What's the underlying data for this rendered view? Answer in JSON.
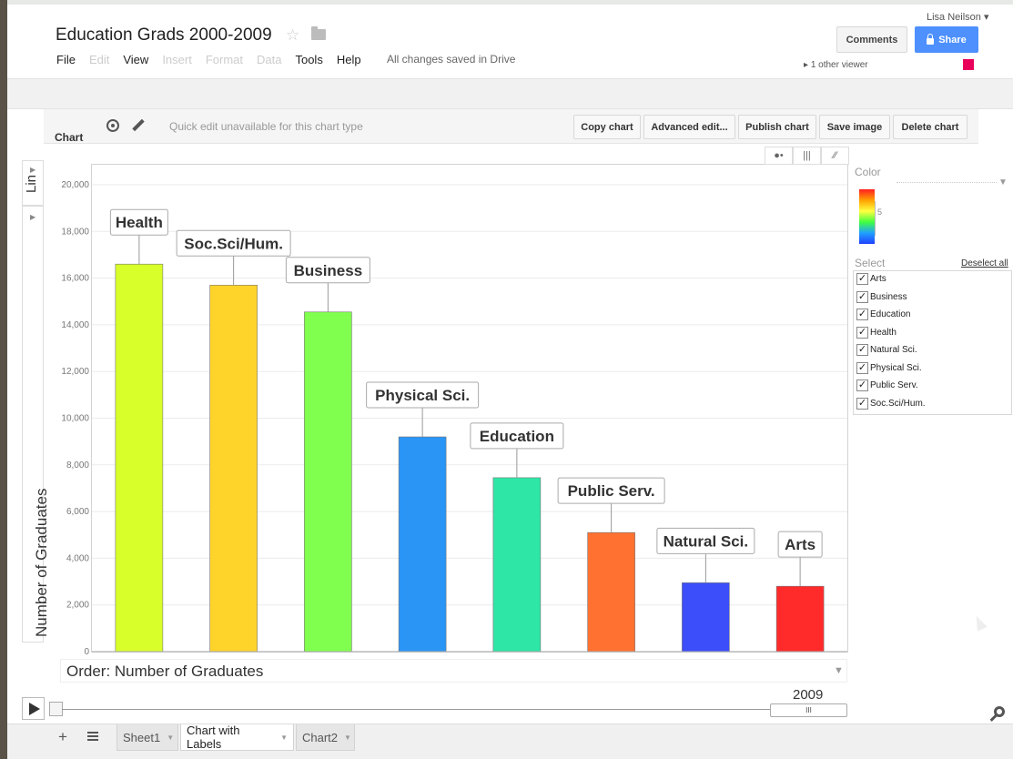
{
  "header": {
    "title": "Education Grads 2000-2009",
    "user": "Lisa Neilson ▾",
    "save_status": "All changes saved in Drive",
    "viewers": "1 other viewer",
    "comments_label": "Comments",
    "share_label": "Share",
    "viewer_color": "#e8005a"
  },
  "menu": [
    "File",
    "Edit",
    "View",
    "Insert",
    "Format",
    "Data",
    "Tools",
    "Help"
  ],
  "chart_toolbar": {
    "label": "Chart",
    "quick_edit": "Quick edit unavailable for this chart type",
    "buttons": [
      "Copy chart",
      "Advanced edit...",
      "Publish chart",
      "Save image",
      "Delete chart"
    ]
  },
  "side_tabs": {
    "lin": "Lin"
  },
  "order": "Order: Number of Graduates",
  "color_panel": {
    "label": "Color",
    "scale_value": "5",
    "select_label": "Select",
    "deselect_all": "Deselect all",
    "items": [
      "Arts",
      "Business",
      "Education",
      "Health",
      "Natural Sci.",
      "Physical Sci.",
      "Public Serv.",
      "Soc.Sci/Hum."
    ]
  },
  "playback": {
    "year": "2009"
  },
  "sheets": [
    "Sheet1",
    "Chart with Labels",
    "Chart2"
  ],
  "chart_data": {
    "type": "bar",
    "categories": [
      "Health",
      "Soc.Sci/Hum.",
      "Business",
      "Physical Sci.",
      "Education",
      "Public Serv.",
      "Natural Sci.",
      "Arts"
    ],
    "values": [
      16600,
      15700,
      14550,
      9200,
      7450,
      5100,
      2950,
      2800
    ],
    "colors": [
      "#d8ff2a",
      "#ffd42a",
      "#80ff4f",
      "#2a95f5",
      "#2ee6a6",
      "#ff7130",
      "#3c4dfa",
      "#ff2a2a"
    ],
    "ylabel": "Number of Graduates",
    "ylim": [
      0,
      20000
    ],
    "yticks": [
      "0",
      "2,000",
      "4,000",
      "6,000",
      "8,000",
      "10,000",
      "12,000",
      "14,000",
      "16,000",
      "18,000",
      "20,000"
    ],
    "grid": true
  }
}
